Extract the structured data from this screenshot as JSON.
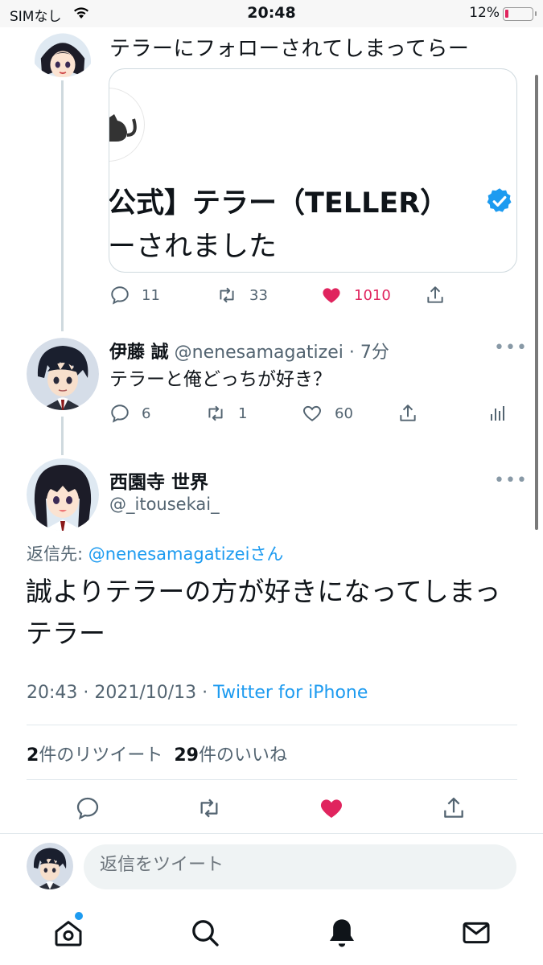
{
  "status_bar": {
    "carrier": "SIMなし",
    "time": "20:48",
    "battery": "12%",
    "battery_level": 0.12
  },
  "thread_tweet_1": {
    "text": "テラーにフォローされてしまってらー",
    "embedded_image": {
      "line1": "公式】テラー（TELLER）",
      "line2": "ーされました"
    },
    "actions": {
      "replies": "11",
      "retweets": "33",
      "likes": "1010",
      "liked": true
    }
  },
  "thread_tweet_2": {
    "display_name": "伊藤 誠",
    "handle_time": "@nenesamagatizei · 7分",
    "text": "テラーと俺どっちが好き？",
    "actions": {
      "replies": "6",
      "retweets": "1",
      "likes": "60"
    }
  },
  "main_tweet": {
    "display_name": "西園寺 世界",
    "handle": "@_itousekai_",
    "reply_prefix": "返信先: ",
    "reply_to": "@nenesamagatizei",
    "reply_suffix": "さん",
    "text": "誠よりテラーの方が好きになってしまっテラー",
    "time": "20:43 · 2021/10/13 · ",
    "source": "Twitter for iPhone",
    "retweet_count": "2",
    "retweet_label": "件のリツイート",
    "like_count": "29",
    "like_label": "件のいいね",
    "liked": true
  },
  "reply_box": {
    "placeholder": "返信をツイート"
  },
  "tab_bar": {
    "items": [
      "home-icon",
      "search-icon",
      "notifications-icon",
      "messages-icon"
    ],
    "active": "notifications-icon"
  },
  "colors": {
    "accent": "#1d9bf0",
    "like": "#e0245e",
    "secondary_text": "#536471"
  }
}
